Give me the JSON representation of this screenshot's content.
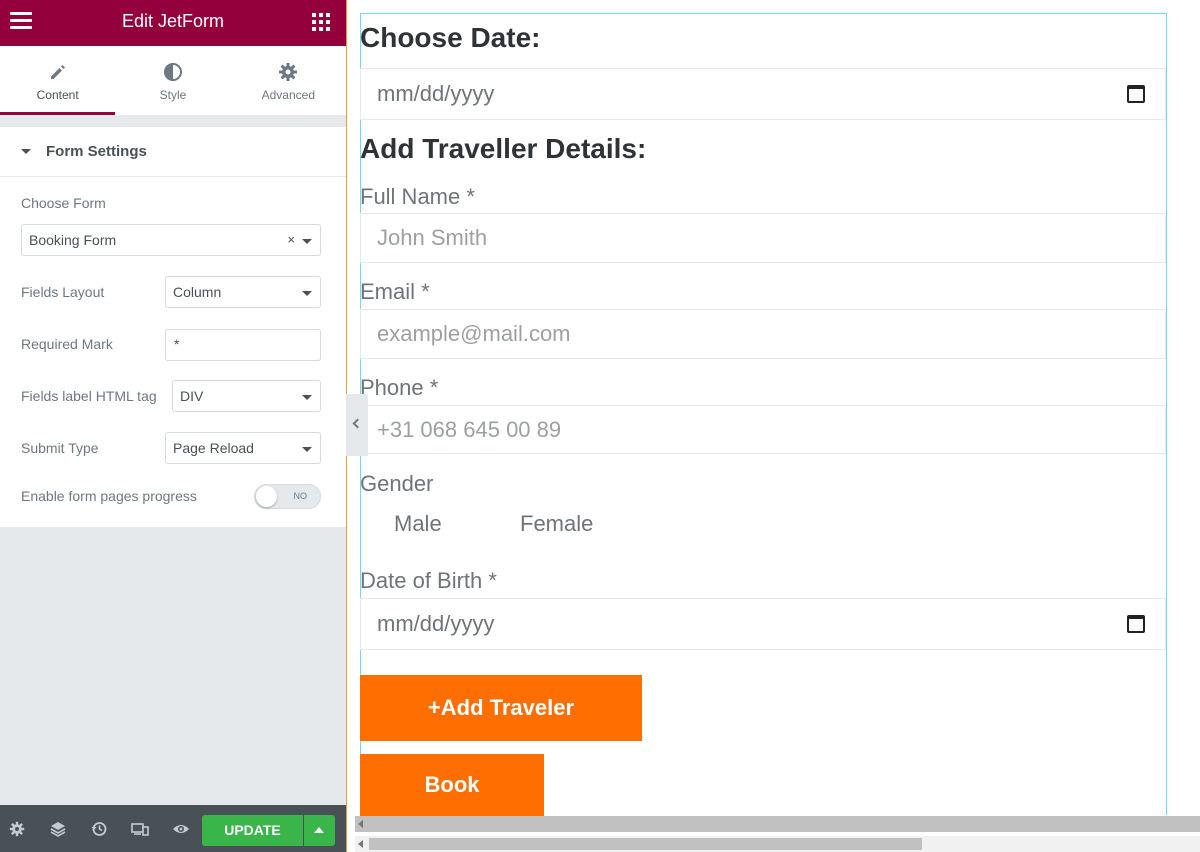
{
  "panel": {
    "title": "Edit JetForm",
    "tabs": [
      {
        "label": "Content",
        "icon": "pencil-icon",
        "active": true
      },
      {
        "label": "Style",
        "icon": "half-circle-icon",
        "active": false
      },
      {
        "label": "Advanced",
        "icon": "gear-icon",
        "active": false
      }
    ],
    "section_title": "Form Settings",
    "controls": {
      "choose_form": {
        "label": "Choose Form",
        "value": "Booking Form",
        "clear": "×"
      },
      "fields_layout": {
        "label": "Fields Layout",
        "value": "Column"
      },
      "required_mark": {
        "label": "Required Mark",
        "value": "*"
      },
      "label_tag": {
        "label": "Fields label HTML tag",
        "value": "DIV"
      },
      "submit_type": {
        "label": "Submit Type",
        "value": "Page Reload"
      },
      "pages_progress": {
        "label": "Enable form pages progress",
        "value": "NO"
      }
    },
    "footer": {
      "icons": [
        "gear-icon",
        "layers-icon",
        "history-icon",
        "responsive-icon",
        "eye-icon"
      ],
      "update_label": "UPDATE"
    }
  },
  "preview": {
    "choose_date_heading": "Choose Date:",
    "choose_date_placeholder": "mm/dd/yyyy",
    "traveller_heading": "Add Traveller Details:",
    "full_name": {
      "label": "Full Name *",
      "placeholder": "John Smith"
    },
    "email": {
      "label": "Email *",
      "placeholder": "example@mail.com"
    },
    "phone": {
      "label": "Phone *",
      "placeholder": "+31 068 645 00 89"
    },
    "gender": {
      "label": "Gender",
      "options": [
        "Male",
        "Female"
      ]
    },
    "dob": {
      "label": "Date of Birth *",
      "placeholder": "mm/dd/yyyy"
    },
    "add_traveler_label": "+Add Traveler",
    "book_label": "Book"
  },
  "colors": {
    "brand": "#93003c",
    "accent_orange": "#ff6e00",
    "update_green": "#39b54a",
    "footer_gray": "#495157"
  }
}
